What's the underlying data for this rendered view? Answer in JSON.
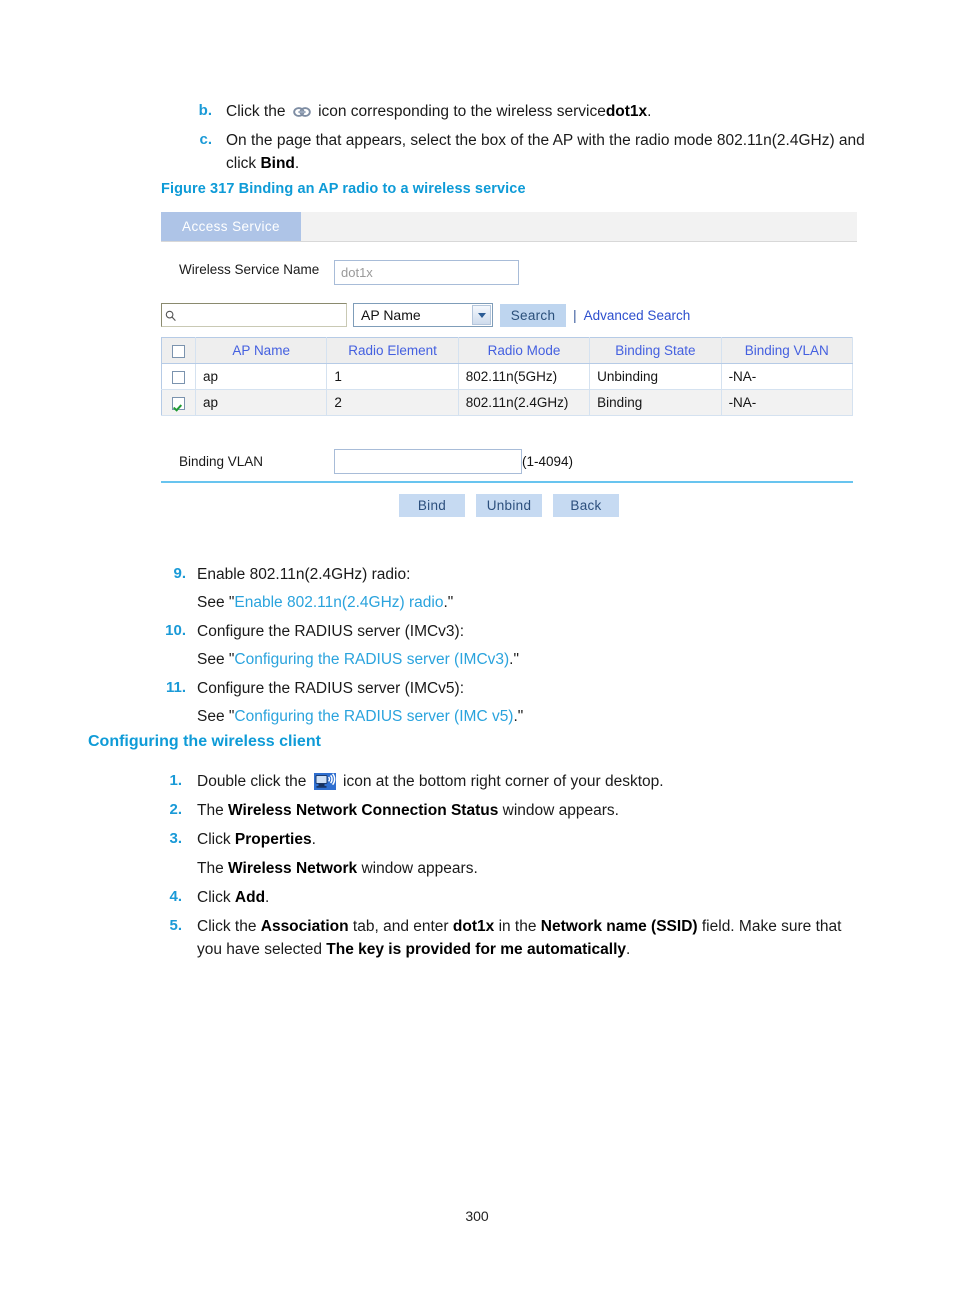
{
  "document": {
    "page_number": "300"
  },
  "sub_steps": [
    {
      "marker": "b.",
      "pre": "Click the",
      "icon": "chain-link-icon",
      "mid": "icon corresponding to the wireless service",
      "bold": "dot1x",
      "post": "."
    },
    {
      "marker": "c.",
      "pre": "On the page that appears, select the box of the AP with the radio mode 802.11n(2.4GHz) and click",
      "bold": "Bind",
      "post": "."
    }
  ],
  "figure": {
    "caption": "Figure 317 Binding an AP radio to a wireless service",
    "tab": {
      "label": "Access Service"
    },
    "service_name": {
      "label": "Wireless Service Name",
      "value": "dot1x"
    },
    "search": {
      "icon": "search-icon",
      "input_value": "",
      "select_value": "AP Name",
      "dropdown_icon": "chevron-down-icon",
      "button_label": "Search",
      "separator": "|",
      "advanced_link": "Advanced Search"
    },
    "table": {
      "headers": [
        "",
        "AP Name",
        "Radio Element",
        "Radio Mode",
        "Binding State",
        "Binding VLAN"
      ],
      "header_checkbox_checked": false,
      "rows": [
        {
          "checked": false,
          "ap_name": "ap",
          "radio_element": "1",
          "radio_mode": "802.11n(5GHz)",
          "binding_state": "Unbinding",
          "binding_vlan": "-NA-"
        },
        {
          "checked": true,
          "ap_name": "ap",
          "radio_element": "2",
          "radio_mode": "802.11n(2.4GHz)",
          "binding_state": "Binding",
          "binding_vlan": "-NA-"
        }
      ]
    },
    "binding_vlan": {
      "label": "Binding VLAN",
      "value": "",
      "hint": "(1-4094)"
    },
    "buttons": [
      {
        "label": "Bind"
      },
      {
        "label": "Unbind"
      },
      {
        "label": "Back"
      }
    ],
    "colors": {
      "tab_background": "#aec4e7",
      "header_link": "#4460e0",
      "button_background": "#c6daf2",
      "rule": "#68c4ef",
      "caption": "#0e9bd7"
    }
  },
  "steps_9_11": [
    {
      "marker": "9.",
      "text": "Enable 802.11n(2.4GHz) radio:",
      "sub_pre": "See \"",
      "sub_link": "Enable 802.11n(2.4GHz) radio",
      "sub_post": ".\""
    },
    {
      "marker": "10.",
      "text": "Configure the RADIUS server (IMCv3):",
      "sub_pre": "See \"",
      "sub_link": "Configuring the RADIUS server (IMCv3)",
      "sub_post": ".\""
    },
    {
      "marker": "11.",
      "text": "Configure the RADIUS server (IMCv5):",
      "sub_pre": "See \"",
      "sub_link": "Configuring the RADIUS server (IMC v5)",
      "sub_post": ".\""
    }
  ],
  "section": {
    "heading": "Configuring the wireless client"
  },
  "steps_1_5": {
    "s1": {
      "marker": "1.",
      "pre": "Double click the",
      "icon": "wireless-network-icon",
      "post": "icon at the bottom right corner of your desktop."
    },
    "s2": {
      "marker": "2.",
      "pre": "The",
      "bold": "Wireless Network Connection Status",
      "post": "window appears."
    },
    "s3": {
      "marker": "3.",
      "pre": "Click",
      "bold": "Properties",
      "post": ".",
      "sub_pre": "The",
      "sub_bold": "Wireless Network",
      "sub_post": "window appears."
    },
    "s4": {
      "marker": "4.",
      "pre": "Click",
      "bold": "Add",
      "post": "."
    },
    "s5": {
      "marker": "5.",
      "p1": "Click the",
      "b1": "Association",
      "p2": "tab, and enter",
      "b2": "dot1x",
      "p3": "in the",
      "b3": "Network name (SSID)",
      "p4": "field. Make sure that you have selected",
      "b4": "The key is provided for me automatically",
      "p5": "."
    }
  }
}
